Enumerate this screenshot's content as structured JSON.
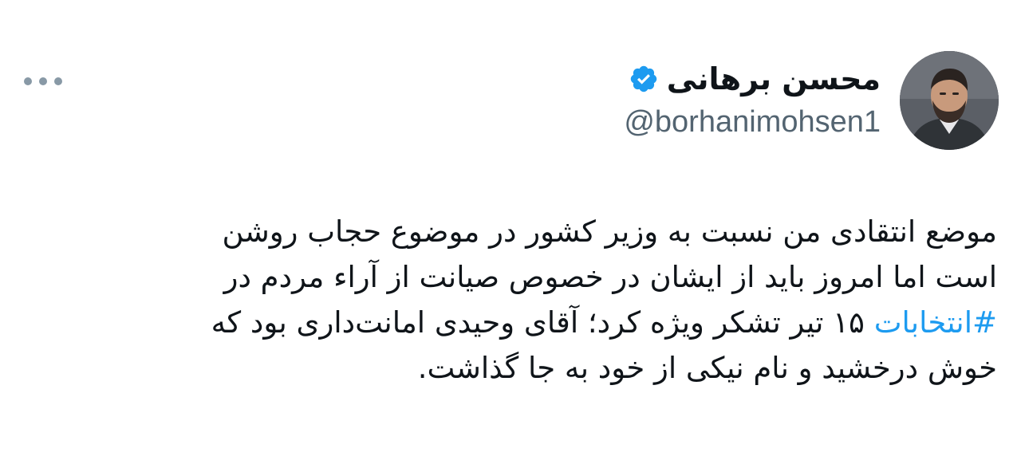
{
  "author": {
    "display_name": "محسن برهانی",
    "handle": "@borhanimohsen1",
    "verified": true,
    "avatar_icon": "person-avatar"
  },
  "menu": {
    "icon": "more-options-icon"
  },
  "tweet": {
    "line1": "موضع انتقادی من نسبت به وزیر کشور در موضوع حجاب روشن",
    "line2": "است اما امروز باید از ایشان در خصوص صیانت از آراء مردم در",
    "line3_hashtag": "#انتخابات",
    "line3_rest": " ۱۵ تیر تشکر ویژه کرد؛ آقای وحیدی امانت‌داری بود که",
    "line4": "خوش درخشید و نام نیکی از خود به جا گذاشت."
  },
  "colors": {
    "accent": "#1d9bf0",
    "text": "#0f1419",
    "secondary": "#536471",
    "dots": "#8899a6"
  }
}
